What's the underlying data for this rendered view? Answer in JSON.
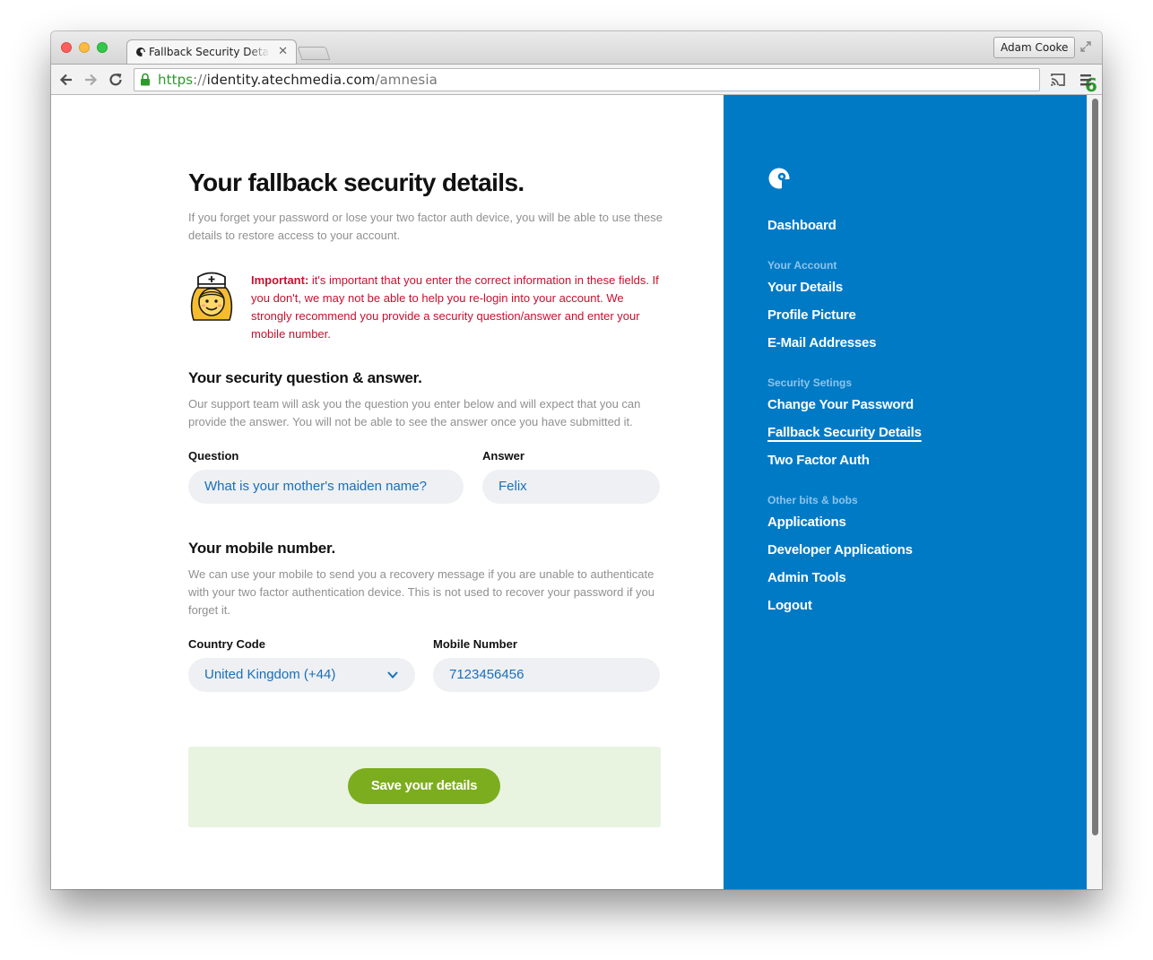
{
  "browser": {
    "tab_title": "Fallback Security Details - aTech Identity",
    "profile_name": "Adam Cooke",
    "url_scheme": "https",
    "url_separator": "://",
    "url_host": "identity.atechmedia.com",
    "url_path": "/amnesia",
    "extension_badge": "6"
  },
  "main": {
    "title": "Your fallback security details.",
    "intro": "If you forget your password or lose your two factor auth device, you will be able to use these details to restore access to your account.",
    "important_label": "Important:",
    "important_text": " it's important that you enter the correct information in these fields. If you don't, we may not be able to help you re-login into your account. We strongly recommend you provide a security question/answer and enter your mobile number.",
    "security": {
      "heading": "Your security question & answer.",
      "description": "Our support team will ask you the question you enter below and will expect that you can provide the answer. You will not be able to see the answer once you have submitted it.",
      "question_label": "Question",
      "question_value": "What is your mother's maiden name?",
      "answer_label": "Answer",
      "answer_value": "Felix"
    },
    "mobile": {
      "heading": "Your mobile number.",
      "description": "We can use your mobile to send you a recovery message if you are unable to authenticate with your two factor authentication device. This is not used to recover your password if you forget it.",
      "country_label": "Country Code",
      "country_value": "United Kingdom (+44)",
      "number_label": "Mobile Number",
      "number_value": "7123456456"
    },
    "save_label": "Save your details"
  },
  "sidebar": {
    "dashboard": "Dashboard",
    "group_account": "Your Account",
    "your_details": "Your Details",
    "profile_picture": "Profile Picture",
    "email_addresses": "E-Mail Addresses",
    "group_security": "Security Setings",
    "change_password": "Change Your Password",
    "fallback_details": "Fallback Security Details",
    "two_factor": "Two Factor Auth",
    "group_other": "Other bits & bobs",
    "applications": "Applications",
    "developer_applications": "Developer Applications",
    "admin_tools": "Admin Tools",
    "logout": "Logout"
  },
  "colors": {
    "sidebar_bg": "#017ac6",
    "accent_green": "#7cad1e",
    "warning_red": "#c8102e",
    "field_text": "#1a6fb8"
  },
  "icons": [
    "nurse-icon",
    "brand-logo-icon",
    "chevron-down-icon",
    "lock-icon",
    "star-icon",
    "cast-icon",
    "menu-icon",
    "back-icon",
    "forward-icon",
    "reload-icon"
  ]
}
